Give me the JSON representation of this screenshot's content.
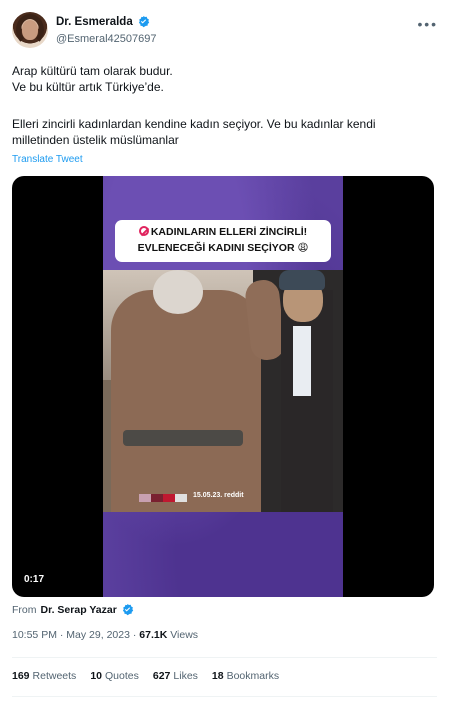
{
  "author": {
    "display_name": "Dr. Esmeralda",
    "handle": "@Esmeral42507697",
    "verified_icon": "verified-badge-icon",
    "avatar": "avatar-photo"
  },
  "menu_icon": "more-options-icon",
  "tweet": {
    "line1": "Arap kültürü tam olarak budur.",
    "line2": "Ve bu kültür artık Türkiye’de.",
    "line3": "Elleri zincirli kadınlardan kendine kadın seçiyor. Ve bu kadınlar kendi",
    "line4": "milletinden üstelik müslümanlar",
    "translate": "Translate Tweet"
  },
  "video": {
    "banner_line1": "KADINLARIN ELLERİ ZİNCİRLİ!",
    "banner_line2": "EVLENECEĞİ KADINI SEÇİYOR 😩",
    "stamp": "15.05.23. reddit",
    "duration": "0:17"
  },
  "source": {
    "prefix": "From",
    "name": "Dr. Serap Yazar"
  },
  "meta": {
    "time": "10:55 PM",
    "date": "May 29, 2023",
    "separator": "·",
    "views_count": "67.1K",
    "views_label": "Views"
  },
  "stats": {
    "retweets_count": "169",
    "retweets_label": "Retweets",
    "quotes_count": "10",
    "quotes_label": "Quotes",
    "likes_count": "627",
    "likes_label": "Likes",
    "bookmarks_count": "18",
    "bookmarks_label": "Bookmarks"
  },
  "colors": {
    "accent": "#1d9bf0",
    "video_bg": "#5a3f9e"
  }
}
